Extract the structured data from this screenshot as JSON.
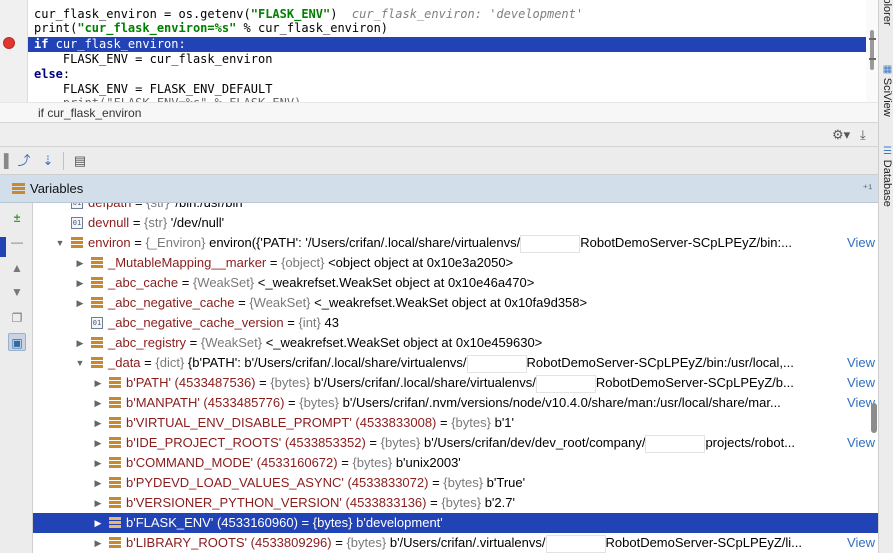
{
  "editor": {
    "lines": [
      {
        "segments": [
          {
            "t": "cur_flask_environ = os.getenv(",
            "c": ""
          },
          {
            "t": "\"FLASK_ENV\"",
            "c": "str"
          },
          {
            "t": ")  ",
            "c": ""
          },
          {
            "t": "cur_flask_environ: 'development'",
            "c": "inline-val"
          }
        ]
      },
      {
        "segments": [
          {
            "t": "print(",
            "c": ""
          },
          {
            "t": "\"cur_flask_environ=%s\"",
            "c": "str"
          },
          {
            "t": " % cur_flask_environ)",
            "c": ""
          }
        ]
      },
      {
        "segments": [
          {
            "t": "if",
            "c": "kw"
          },
          {
            "t": " cur_flask_environ:",
            "c": ""
          }
        ]
      },
      {
        "segments": [
          {
            "t": "    FLASK_ENV = cur_flask_environ",
            "c": ""
          }
        ]
      },
      {
        "segments": [
          {
            "t": "else",
            "c": "kw"
          },
          {
            "t": ":",
            "c": ""
          }
        ]
      },
      {
        "segments": [
          {
            "t": "    FLASK_ENV = FLASK_ENV_DEFAULT",
            "c": ""
          }
        ]
      }
    ],
    "breadcrumb": "if cur_flask_environ"
  },
  "right_strip": {
    "tabs": [
      "xplorer",
      "SciView",
      "Database"
    ],
    "icons": [
      "sciview-icon",
      "database-icon"
    ]
  },
  "toolbar": {
    "top_icons": [
      "gear-icon",
      "download-icon"
    ],
    "icons": [
      "step-over-icon",
      "step-into-icon",
      "step-into-my-code-icon",
      "evaluate-table-icon"
    ]
  },
  "variables": {
    "title": "Variables",
    "pin_label": "⁺¹",
    "view_label": "View",
    "rows": [
      {
        "depth": 0,
        "arrow": "",
        "icon": "box",
        "name": "defpath",
        "type": "{str}",
        "value": "'/bin:/usr/bin'",
        "partial": true
      },
      {
        "depth": 0,
        "arrow": "",
        "icon": "box",
        "name": "devnull",
        "type": "{str}",
        "value": "'/dev/null'"
      },
      {
        "depth": 0,
        "arrow": "down",
        "icon": "bars",
        "name": "environ",
        "type": "{_Environ}",
        "value": "environ({'PATH': '/Users/crifan/.local/share/virtualenvs/",
        "redact": true,
        "suffix": "RobotDemoServer-SCpLPEyZ/bin:...",
        "view": true
      },
      {
        "depth": 1,
        "arrow": "right",
        "icon": "bars",
        "name": "_MutableMapping__marker",
        "type": "{object}",
        "value": "<object object at 0x10e3a2050>"
      },
      {
        "depth": 1,
        "arrow": "right",
        "icon": "bars",
        "name": "_abc_cache",
        "type": "{WeakSet}",
        "value": "<_weakrefset.WeakSet object at 0x10e46a470>"
      },
      {
        "depth": 1,
        "arrow": "right",
        "icon": "bars",
        "name": "_abc_negative_cache",
        "type": "{WeakSet}",
        "value": "<_weakrefset.WeakSet object at 0x10fa9d358>"
      },
      {
        "depth": 1,
        "arrow": "",
        "icon": "box",
        "name": "_abc_negative_cache_version",
        "type": "{int}",
        "value": "43"
      },
      {
        "depth": 1,
        "arrow": "right",
        "icon": "bars",
        "name": "_abc_registry",
        "type": "{WeakSet}",
        "value": "<_weakrefset.WeakSet object at 0x10e459630>"
      },
      {
        "depth": 1,
        "arrow": "down",
        "icon": "bars",
        "name": "_data",
        "type": "{dict}",
        "value": "{b'PATH': b'/Users/crifan/.local/share/virtualenvs/",
        "redact": true,
        "suffix": "RobotDemoServer-SCpLPEyZ/bin:/usr/local,...",
        "view": true
      },
      {
        "depth": 2,
        "arrow": "right",
        "icon": "bars",
        "name": "b'PATH' (4533487536)",
        "type": "{bytes}",
        "value": "b'/Users/crifan/.local/share/virtualenvs/",
        "redact": true,
        "suffix": "RobotDemoServer-SCpLPEyZ/b...",
        "view": true
      },
      {
        "depth": 2,
        "arrow": "right",
        "icon": "bars",
        "name": "b'MANPATH' (4533485776)",
        "type": "{bytes}",
        "value": "b'/Users/crifan/.nvm/versions/node/v10.4.0/share/man:/usr/local/share/mar...",
        "view": true
      },
      {
        "depth": 2,
        "arrow": "right",
        "icon": "bars",
        "name": "b'VIRTUAL_ENV_DISABLE_PROMPT' (4533833008)",
        "type": "{bytes}",
        "value": "b'1'"
      },
      {
        "depth": 2,
        "arrow": "right",
        "icon": "bars",
        "name": "b'IDE_PROJECT_ROOTS' (4533853352)",
        "type": "{bytes}",
        "value": "b'/Users/crifan/dev/dev_root/company/",
        "redact": true,
        "suffix": "projects/robot...",
        "view": true
      },
      {
        "depth": 2,
        "arrow": "right",
        "icon": "bars",
        "name": "b'COMMAND_MODE' (4533160672)",
        "type": "{bytes}",
        "value": "b'unix2003'"
      },
      {
        "depth": 2,
        "arrow": "right",
        "icon": "bars",
        "name": "b'PYDEVD_LOAD_VALUES_ASYNC' (4533833072)",
        "type": "{bytes}",
        "value": "b'True'"
      },
      {
        "depth": 2,
        "arrow": "right",
        "icon": "bars",
        "name": "b'VERSIONER_PYTHON_VERSION' (4533833136)",
        "type": "{bytes}",
        "value": "b'2.7'"
      },
      {
        "depth": 2,
        "arrow": "right",
        "icon": "bars",
        "name": "b'FLASK_ENV' (4533160960)",
        "type": "{bytes}",
        "value": "b'development'",
        "selected": true
      },
      {
        "depth": 2,
        "arrow": "right",
        "icon": "bars",
        "name": "b'LIBRARY_ROOTS' (4533809296)",
        "type": "{bytes}",
        "value": "b'/Users/crifan/.virtualenvs/",
        "redact": true,
        "suffix": "RobotDemoServer-SCpLPEyZ/li...",
        "view": true
      }
    ]
  },
  "colors": {
    "selection": "#2243b6",
    "var_name": "#8a1c1c",
    "type_hint": "#7a7a7a",
    "link": "#2f6fbf",
    "breakpoint": "#e0362f"
  }
}
